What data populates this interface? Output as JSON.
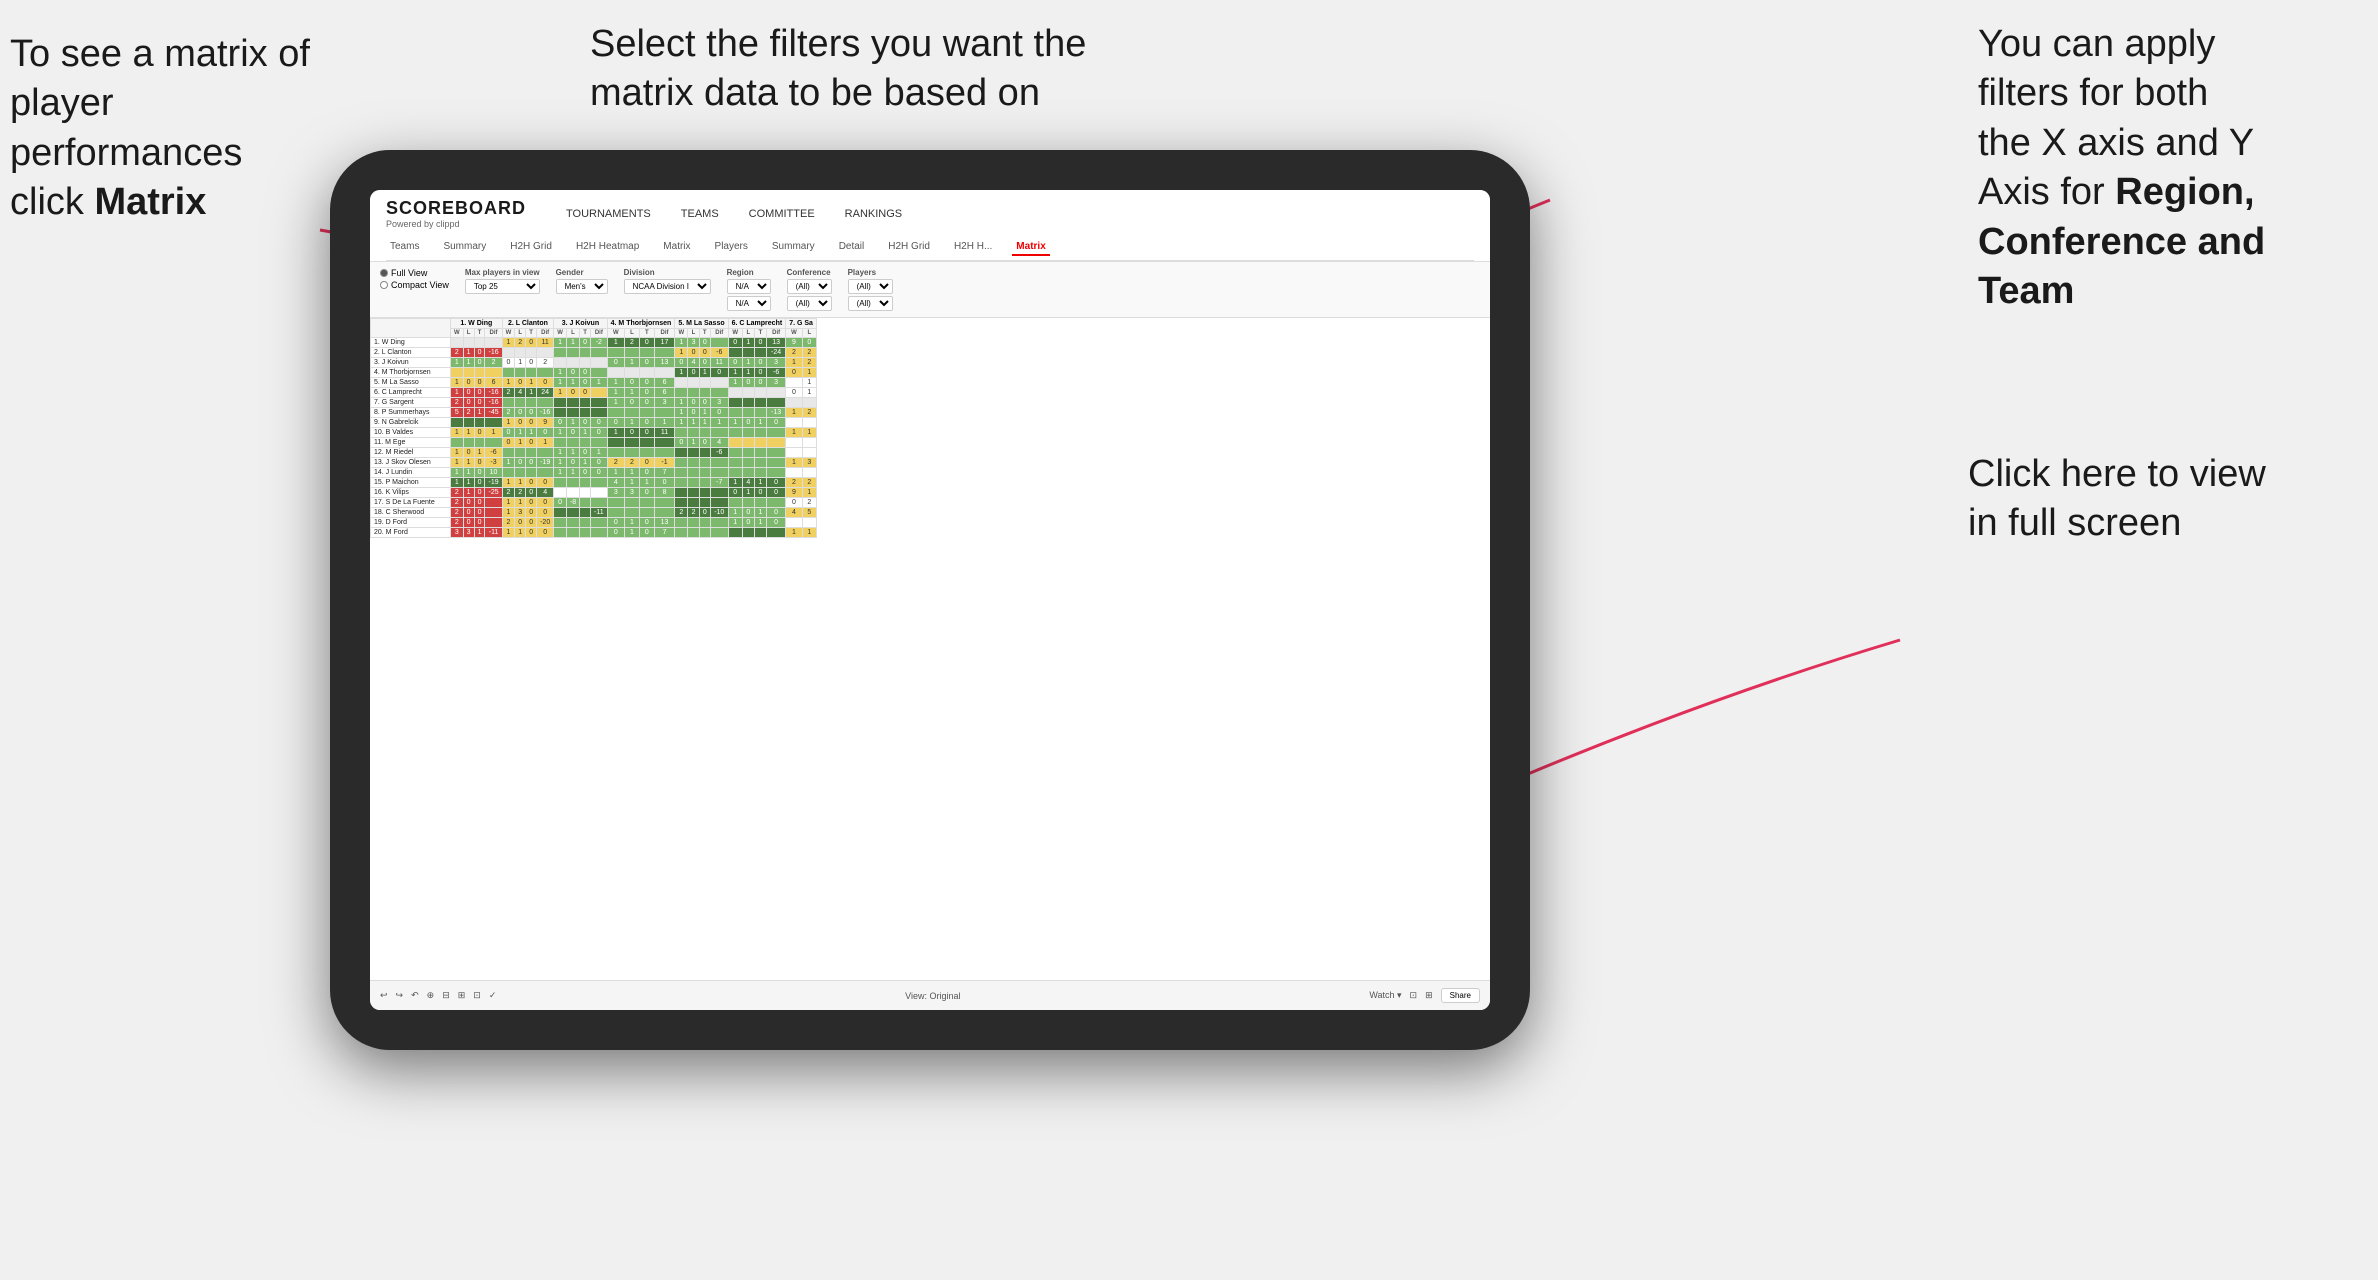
{
  "annotations": {
    "left": {
      "line1": "To see a matrix of",
      "line2": "player performances",
      "line3_prefix": "click ",
      "line3_bold": "Matrix"
    },
    "center": {
      "text": "Select the filters you want the matrix data to be based on"
    },
    "right": {
      "line1": "You  can apply",
      "line2": "filters for both",
      "line3": "the X axis and Y",
      "line4_prefix": "Axis for ",
      "line4_bold": "Region,",
      "line5_bold": "Conference and",
      "line6_bold": "Team"
    },
    "bottomRight": {
      "line1": "Click here to view",
      "line2": "in full screen"
    }
  },
  "brand": {
    "name": "SCOREBOARD",
    "sub": "Powered by clippd"
  },
  "nav": {
    "main": [
      "TOURNAMENTS",
      "TEAMS",
      "COMMITTEE",
      "RANKINGS"
    ],
    "sub": [
      "Teams",
      "Summary",
      "H2H Grid",
      "H2H Heatmap",
      "Matrix",
      "Players",
      "Summary",
      "Detail",
      "H2H Grid",
      "H2H H...",
      "Matrix"
    ]
  },
  "filters": {
    "view": {
      "options": [
        "Full View",
        "Compact View"
      ],
      "selected": "Full View"
    },
    "maxPlayers": {
      "label": "Max players in view",
      "value": "Top 25"
    },
    "gender": {
      "label": "Gender",
      "value": "Men's"
    },
    "division": {
      "label": "Division",
      "value": "NCAA Division I"
    },
    "region": {
      "label": "Region",
      "values": [
        "N/A",
        "N/A"
      ]
    },
    "conference": {
      "label": "Conference",
      "values": [
        "(All)",
        "(All)"
      ]
    },
    "players": {
      "label": "Players",
      "values": [
        "(All)",
        "(All)"
      ]
    }
  },
  "matrix": {
    "columns": [
      "1. W Ding",
      "2. L Clanton",
      "3. J Koivun",
      "4. M Thorbjornsen",
      "5. M La Sasso",
      "6. C Lamprecht",
      "7. G Sa"
    ],
    "subCols": [
      "W",
      "L",
      "T",
      "Dif"
    ],
    "rows": [
      {
        "label": "1. W Ding",
        "rank": 1
      },
      {
        "label": "2. L Clanton",
        "rank": 2
      },
      {
        "label": "3. J Koivun",
        "rank": 3
      },
      {
        "label": "4. M Thorbjornsen",
        "rank": 4
      },
      {
        "label": "5. M La Sasso",
        "rank": 5
      },
      {
        "label": "6. C Lamprecht",
        "rank": 6
      },
      {
        "label": "7. G Sargent",
        "rank": 7
      },
      {
        "label": "8. P Summerhays",
        "rank": 8
      },
      {
        "label": "9. N Gabrelcik",
        "rank": 9
      },
      {
        "label": "10. B Valdes",
        "rank": 10
      },
      {
        "label": "11. M Ege",
        "rank": 11
      },
      {
        "label": "12. M Riedel",
        "rank": 12
      },
      {
        "label": "13. J Skov Olesen",
        "rank": 13
      },
      {
        "label": "14. J Lundin",
        "rank": 14
      },
      {
        "label": "15. P Maichon",
        "rank": 15
      },
      {
        "label": "16. K Vilips",
        "rank": 16
      },
      {
        "label": "17. S De La Fuente",
        "rank": 17
      },
      {
        "label": "18. C Sherwood",
        "rank": 18
      },
      {
        "label": "19. D Ford",
        "rank": 19
      },
      {
        "label": "20. M Ford",
        "rank": 20
      }
    ]
  },
  "bottomBar": {
    "leftIcons": [
      "↩",
      "↪",
      "↶",
      "⊕",
      "⊟",
      "⊞",
      "⊡",
      "✓"
    ],
    "centerLabel": "View: Original",
    "rightItems": [
      "Watch ▾",
      "⊡",
      "⊞",
      "Share"
    ]
  }
}
